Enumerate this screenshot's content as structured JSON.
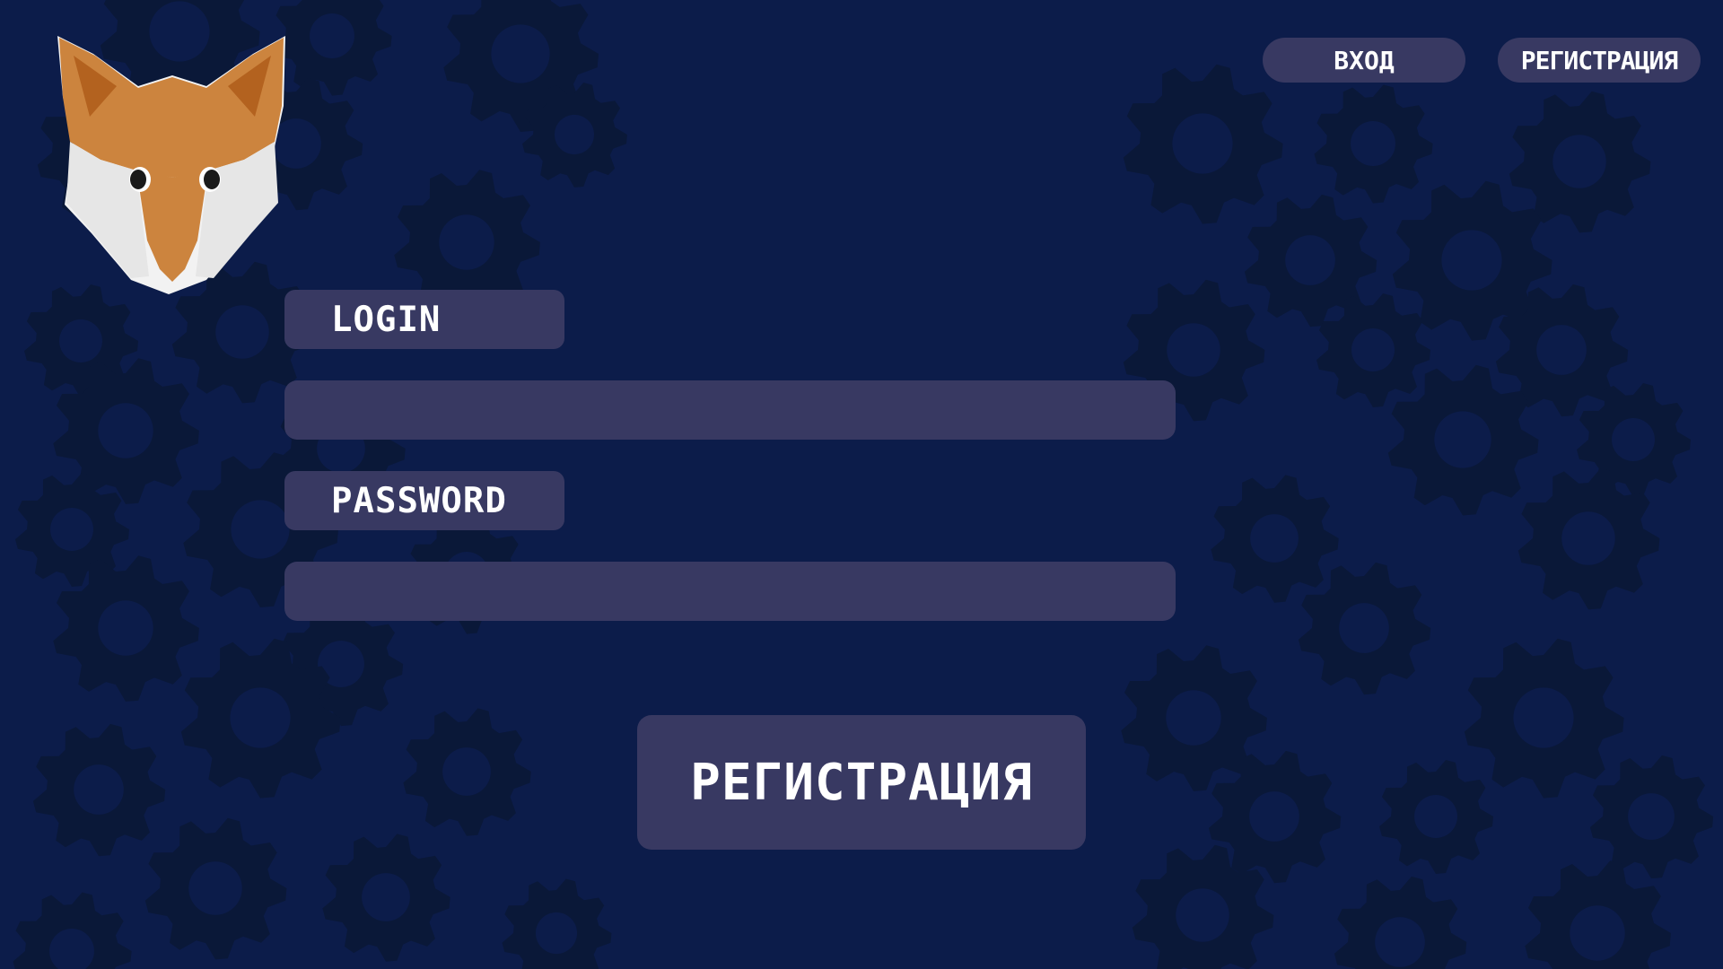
{
  "colors": {
    "background": "#0c1c4a",
    "gear": "#0a1838",
    "panel": "#383962",
    "text": "#ffffff",
    "fox_orange": "#cc843e",
    "fox_orange_dark": "#b3621f",
    "fox_white": "#e8e8e8"
  },
  "logo": {
    "icon": "fox-head-icon"
  },
  "nav": {
    "login_label": "ВХОД",
    "register_label": "РЕГИСТРАЦИЯ"
  },
  "form": {
    "login_label": "LOGIN",
    "login_value": "",
    "password_label": "PASSWORD",
    "password_value": "",
    "submit_label": "РЕГИСТРАЦИЯ"
  }
}
